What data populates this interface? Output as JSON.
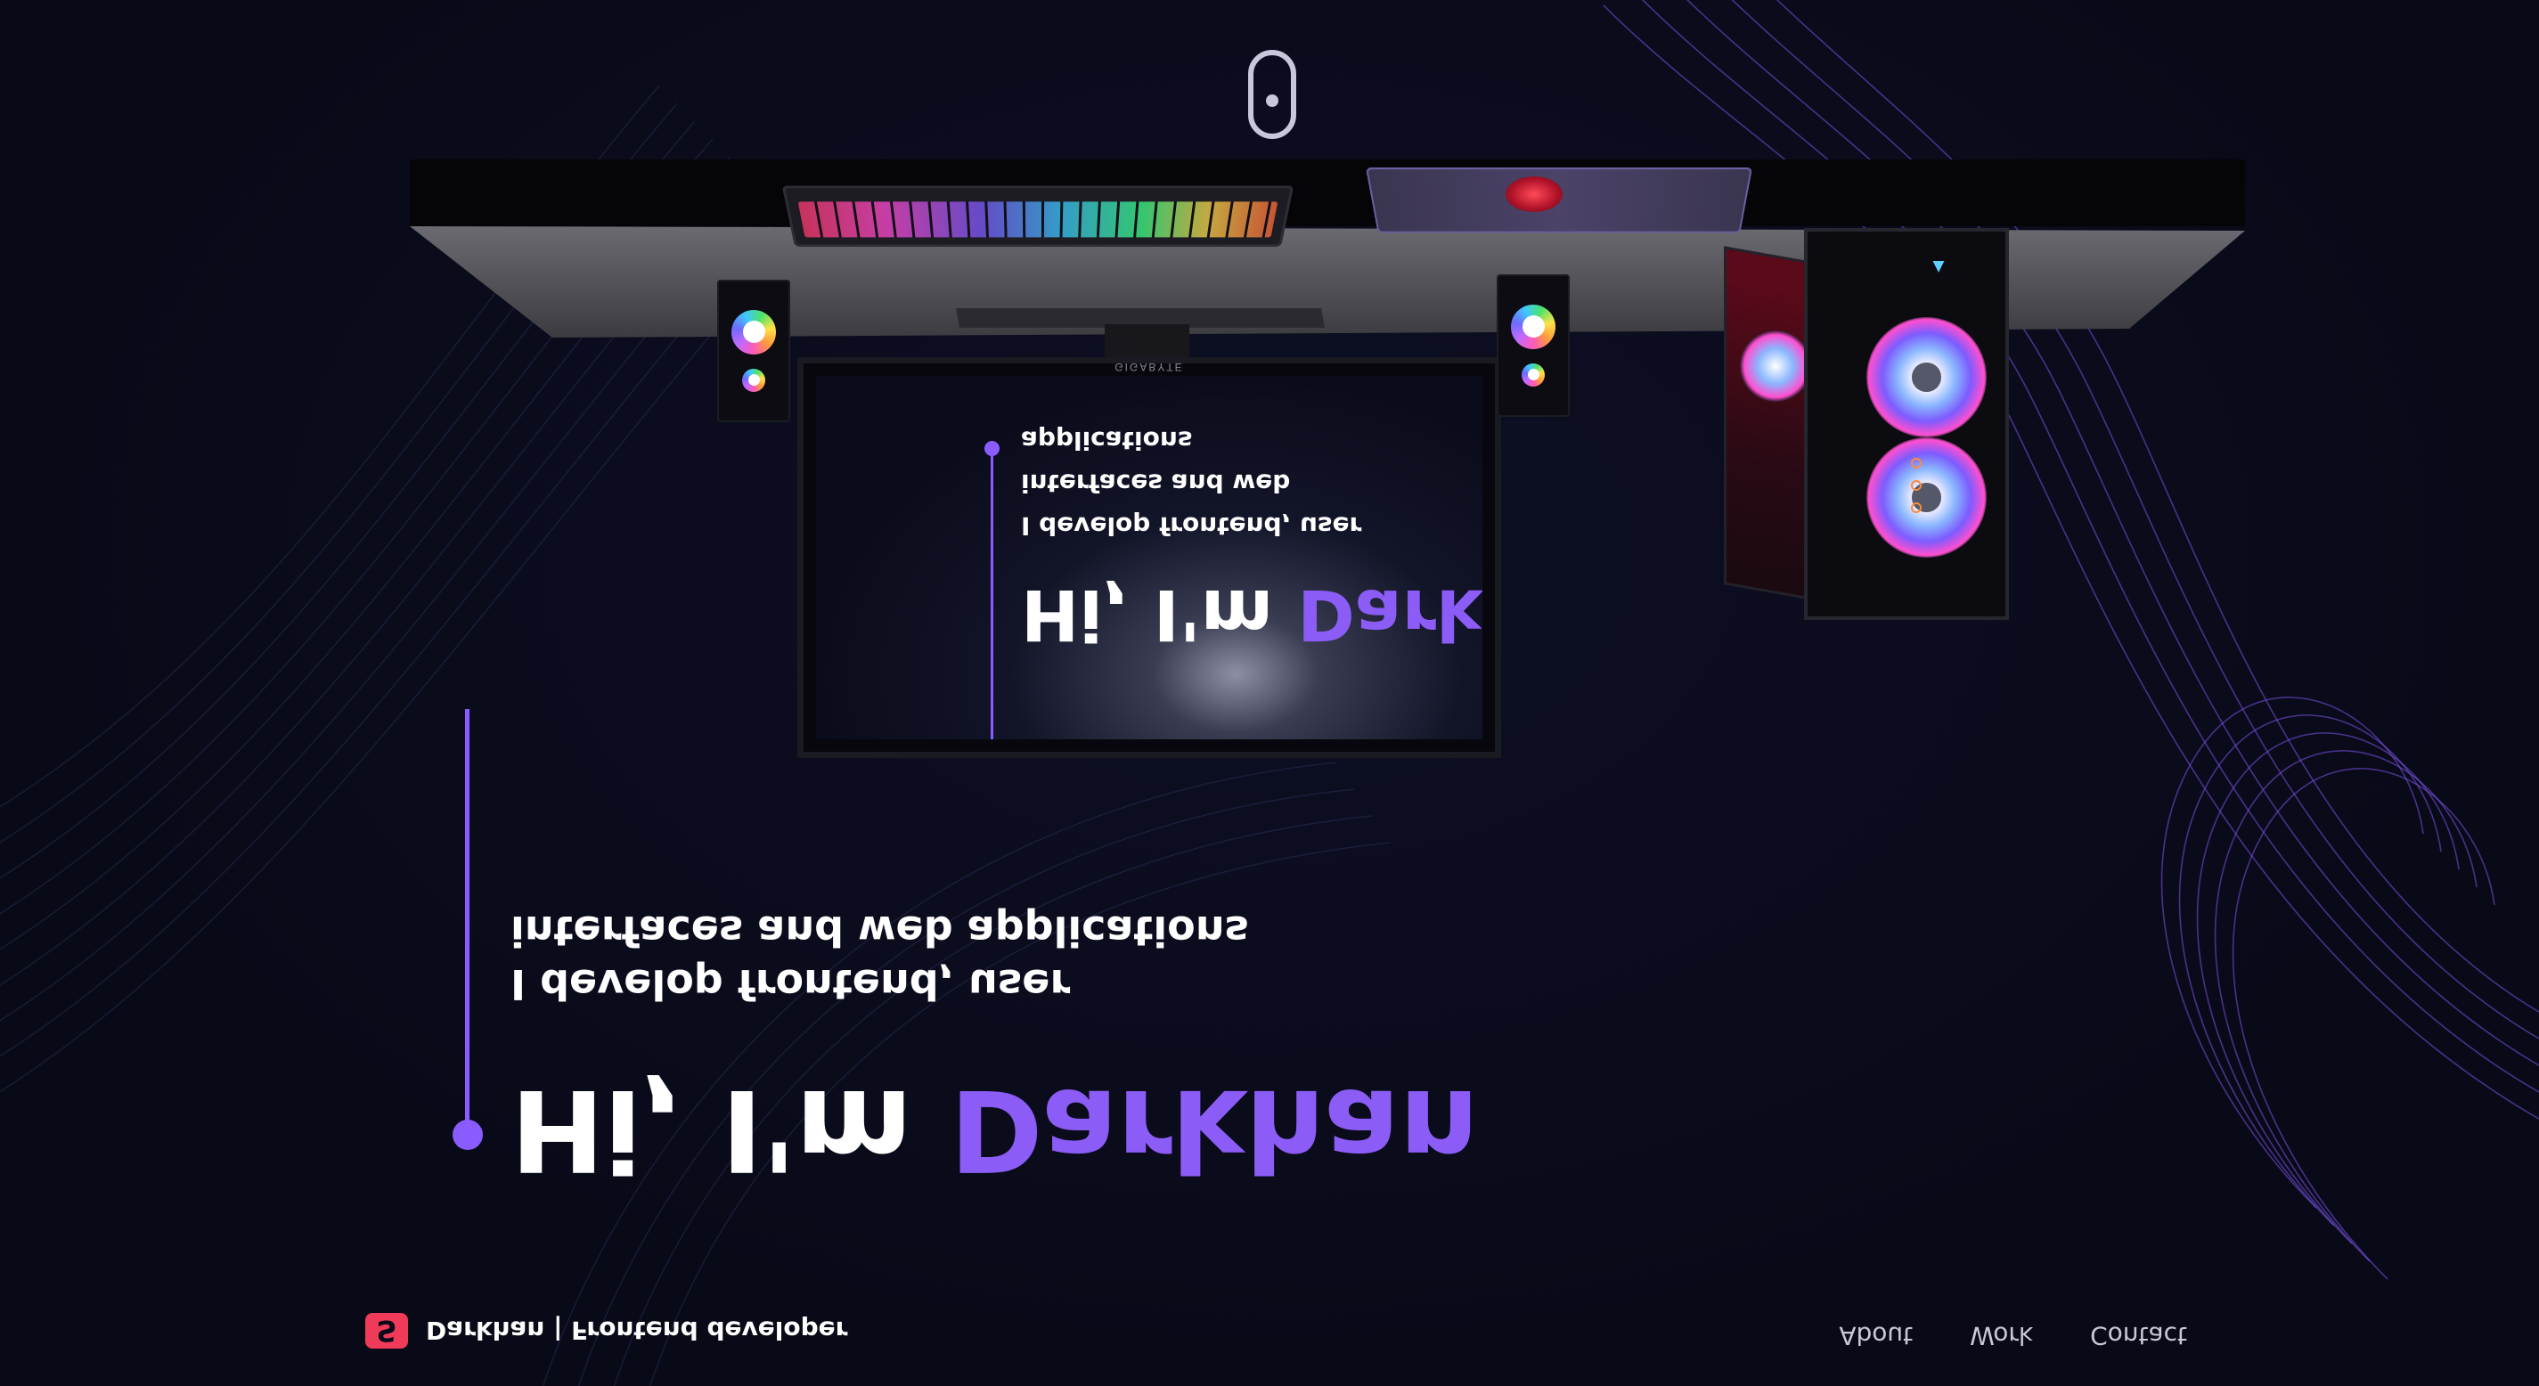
{
  "brand": {
    "logo_glyph": "S",
    "name": "Darkhan",
    "separator": " | ",
    "role": "Frontend developer"
  },
  "nav": {
    "items": [
      "About",
      "Work",
      "Contact"
    ]
  },
  "hero": {
    "title_lead": "Hi, I'm ",
    "title_accent": "Darkhan",
    "subtitle_line1": "I develop frontend, user",
    "subtitle_line2": "interfaces and web applications"
  },
  "monitor": {
    "brand": "GIGABYTE",
    "title_lead": "Hi, I'm ",
    "title_accent": "Darkhan",
    "subtitle_line1": "I develop frontend, user",
    "subtitle_line2": "interfaces and web applications"
  },
  "icons": {
    "brand_logo": "brand-logo-icon",
    "camera": "mouse-scroll-icon",
    "pc_logo": "pc-brand-icon"
  },
  "colors": {
    "background": "#0a0b1a",
    "accent": "#8c5cf6",
    "brand_logo": "#f03a5a",
    "nav_text": "#c9c9d6"
  }
}
